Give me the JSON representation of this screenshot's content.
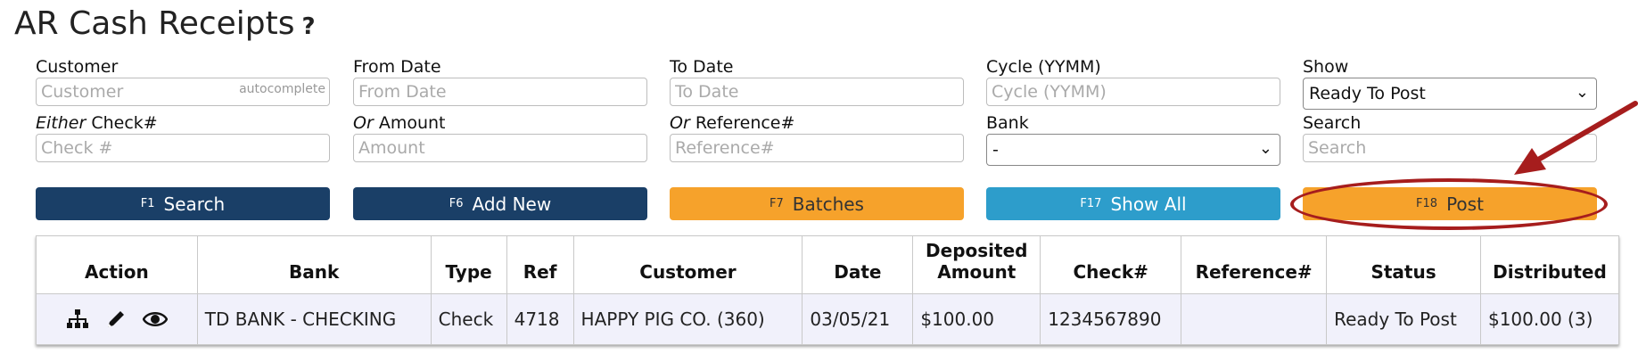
{
  "page": {
    "title": "AR Cash Receipts",
    "help": "?"
  },
  "filters": {
    "customer": {
      "label": "Customer",
      "placeholder": "Customer",
      "hint": "autocomplete"
    },
    "from_date": {
      "label": "From Date",
      "placeholder": "From Date"
    },
    "to_date": {
      "label": "To Date",
      "placeholder": "To Date"
    },
    "cycle": {
      "label": "Cycle (YYMM)",
      "placeholder": "Cycle (YYMM)"
    },
    "show": {
      "label": "Show",
      "value": "Ready To Post"
    },
    "check": {
      "label_em": "Either",
      "label": " Check#",
      "placeholder": "Check #"
    },
    "amount": {
      "label_em": "Or",
      "label": " Amount",
      "placeholder": "Amount"
    },
    "reference": {
      "label_em": "Or",
      "label": " Reference#",
      "placeholder": "Reference#"
    },
    "bank": {
      "label": "Bank",
      "value": "-"
    },
    "search": {
      "label": "Search",
      "placeholder": "Search"
    }
  },
  "buttons": [
    {
      "key": "F1",
      "label": "Search",
      "color": "#1a3f67"
    },
    {
      "key": "F6",
      "label": "Add New",
      "color": "#1a3f67"
    },
    {
      "key": "F7",
      "label": "Batches",
      "color": "#f6a22b"
    },
    {
      "key": "F17",
      "label": "Show All",
      "color": "#2d9dcb"
    },
    {
      "key": "F18",
      "label": "Post",
      "color": "#f6a22b"
    }
  ],
  "annotation": {
    "color": "#a61d1d"
  },
  "table": {
    "headers": [
      "Action",
      "Bank",
      "Type",
      "Ref",
      "Customer",
      "Date",
      "Deposited Amount",
      "Check#",
      "Reference#",
      "Status",
      "Distributed"
    ],
    "rows": [
      {
        "bank": "TD BANK - CHECKING",
        "type": "Check",
        "ref": "4718",
        "customer": "HAPPY PIG CO. (360)",
        "date": "03/05/21",
        "deposited": "$100.00",
        "check": "1234567890",
        "reference": "",
        "status": "Ready To Post",
        "distributed": "$100.00 (3)"
      }
    ],
    "action_icons": [
      "hierarchy-icon",
      "pencil-icon",
      "eye-icon"
    ]
  }
}
